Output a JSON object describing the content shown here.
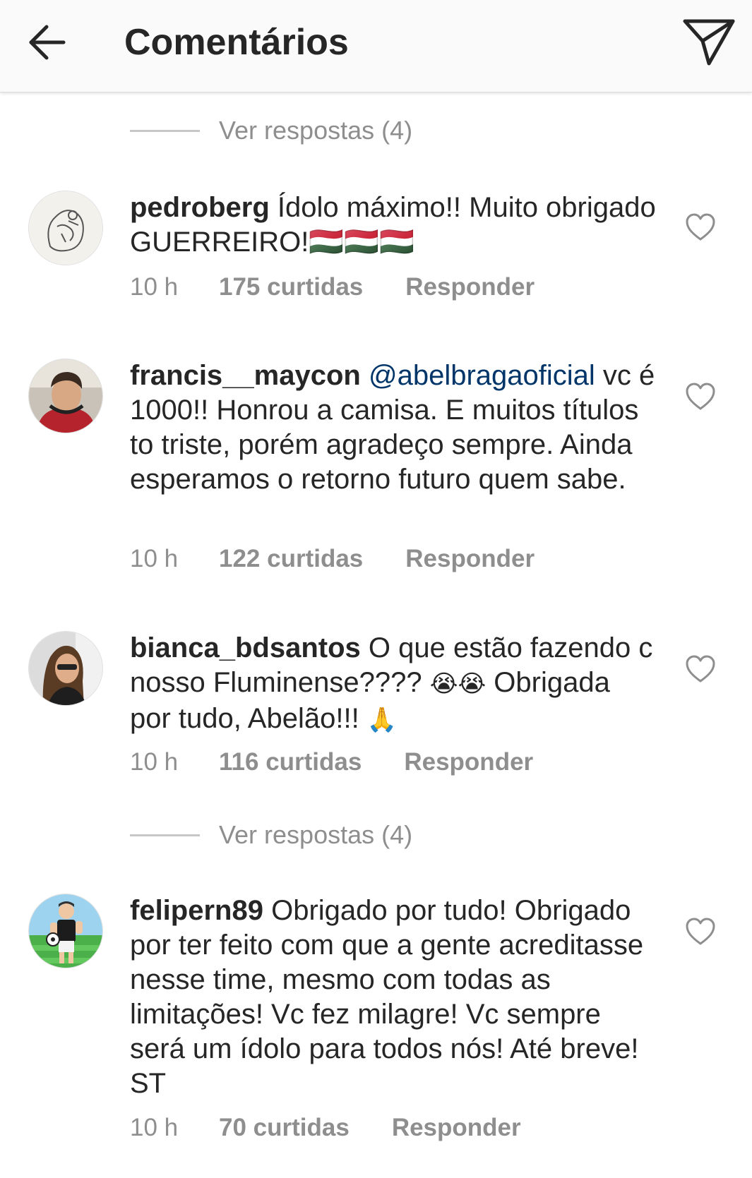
{
  "header": {
    "title": "Comentários",
    "back_icon": "arrow-left-icon",
    "send_icon": "paper-plane-icon"
  },
  "replies_links": [
    {
      "label": "Ver respostas (4)"
    },
    {
      "label": "Ver respostas (4)"
    }
  ],
  "comments": [
    {
      "username": "pedroberg",
      "text": "Ídolo máximo!! Muito obrigado GUERREIRO!🇭🇺🇭🇺🇭🇺",
      "time": "10 h",
      "likes": "175 curtidas",
      "reply_label": "Responder"
    },
    {
      "username": "francis__maycon",
      "mention": "@abelbragaoficial",
      "text": " vc é 1000!! Honrou  a camisa. E muitos títulos to triste, porém agradeço sempre. Ainda esperamos o retorno futuro quem sabe.",
      "time": "10 h",
      "likes": "122 curtidas",
      "reply_label": "Responder"
    },
    {
      "username": "bianca_bdsantos",
      "text_a": "O que estão fazendo c nosso Fluminense???? ",
      "emoji_a": "😭😭",
      "text_b": " Obrigada por tudo, Abelão!!! ",
      "emoji_b": "🙏",
      "time": "10 h",
      "likes": "116 curtidas",
      "reply_label": "Responder"
    },
    {
      "username": "felipern89",
      "text": "Obrigado por tudo! Obrigado por ter feito com que a gente acreditasse nesse time, mesmo com todas as limitações! Vc fez milagre! Vc sempre será um ídolo para todos nós! Até breve! ST",
      "time": "10 h",
      "likes": "70 curtidas",
      "reply_label": "Responder"
    }
  ],
  "colors": {
    "text": "#262626",
    "muted": "#8e8e8e",
    "mention": "#003569",
    "header_bg": "#fafafa"
  }
}
